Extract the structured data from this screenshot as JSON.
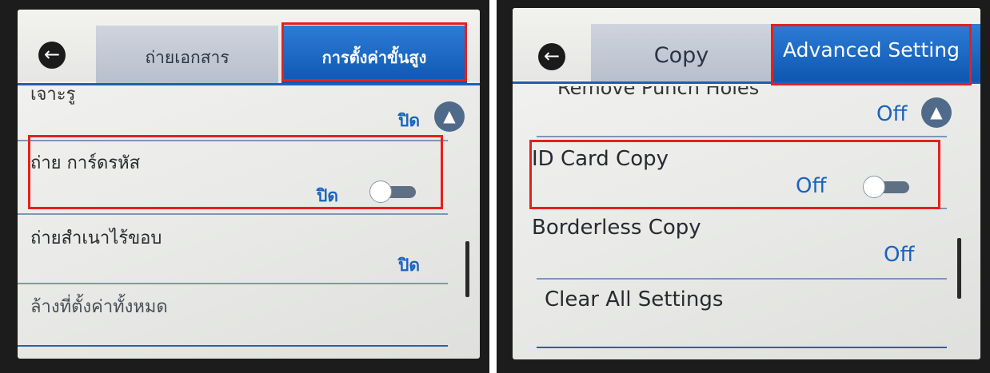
{
  "left_panel": {
    "tabs": {
      "copy": "ถ่ายเอกสาร",
      "advanced": "การตั้งค่าขั้นสูง"
    },
    "scrolled_item_partial": "เจาะรู",
    "rows": [
      {
        "label": "",
        "value": "ปิด"
      },
      {
        "label": "ถ่าย การ์ดรหัส",
        "value": "ปิด"
      },
      {
        "label": "ถ่ายสำเนาไร้ขอบ",
        "value": "ปิด"
      },
      {
        "label": "ล้างที่ตั้งค่าทั้งหมด",
        "value": ""
      }
    ]
  },
  "right_panel": {
    "tabs": {
      "copy": "Copy",
      "advanced": "Advanced Setting"
    },
    "scrolled_item_partial": "Remove Punch Holes",
    "rows": [
      {
        "label": "",
        "value": "Off"
      },
      {
        "label": "ID Card Copy",
        "value": "Off"
      },
      {
        "label": "Borderless Copy",
        "value": "Off"
      },
      {
        "label": "Clear All Settings",
        "value": ""
      }
    ]
  },
  "icons": {
    "back": "arrow-left-circle-icon",
    "scroll_up": "chevron-up-circle-icon",
    "toggle": "toggle-switch-icon"
  },
  "colors": {
    "active_tab": "#1662c0",
    "highlight": "#e5201c",
    "value_text": "#1a63c0"
  }
}
